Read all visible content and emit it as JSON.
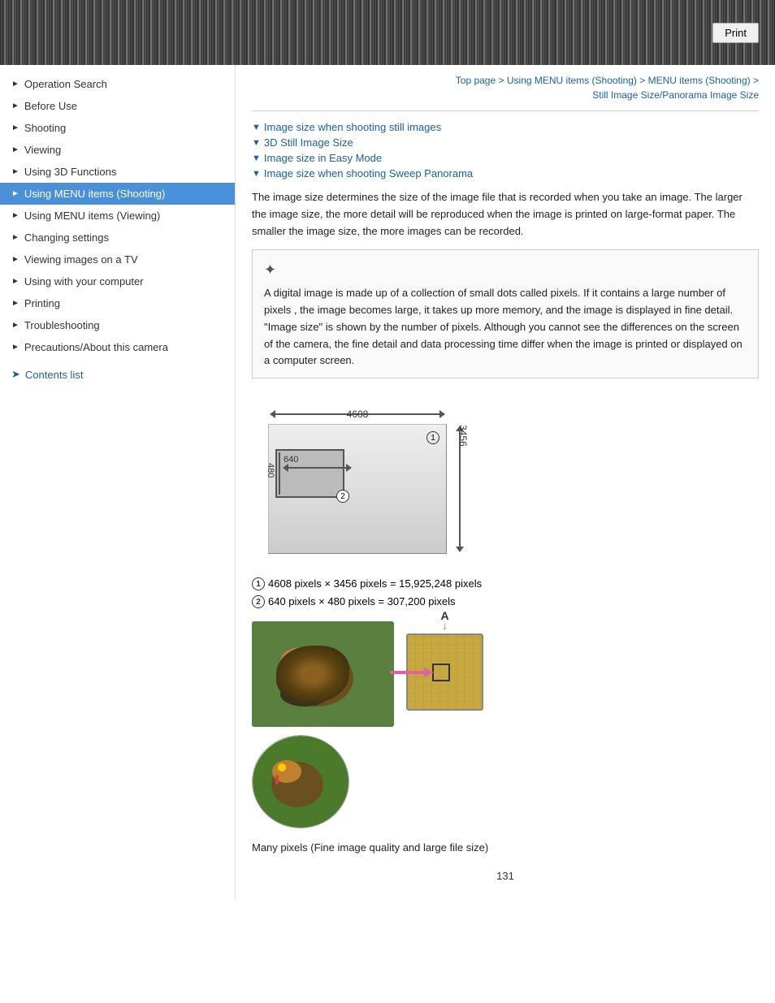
{
  "header": {
    "print_label": "Print"
  },
  "breadcrumb": {
    "part1": "Top page",
    "sep1": " > ",
    "part2": "Using MENU items (Shooting)",
    "sep2": " > ",
    "part3": "MENU items (Shooting)",
    "sep3": " > ",
    "part4": "Still Image Size/Panorama Image Size"
  },
  "sidebar": {
    "items": [
      {
        "label": "Operation Search",
        "active": false
      },
      {
        "label": "Before Use",
        "active": false
      },
      {
        "label": "Shooting",
        "active": false
      },
      {
        "label": "Viewing",
        "active": false
      },
      {
        "label": "Using 3D Functions",
        "active": false
      },
      {
        "label": "Using MENU items (Shooting)",
        "active": true
      },
      {
        "label": "Using MENU items (Viewing)",
        "active": false
      },
      {
        "label": "Changing settings",
        "active": false
      },
      {
        "label": "Viewing images on a TV",
        "active": false
      },
      {
        "label": "Using with your computer",
        "active": false
      },
      {
        "label": "Printing",
        "active": false
      },
      {
        "label": "Troubleshooting",
        "active": false
      },
      {
        "label": "Precautions/About this camera",
        "active": false
      }
    ],
    "contents_link": "Contents list"
  },
  "toc": {
    "items": [
      {
        "label": "Image size when shooting still images"
      },
      {
        "label": "3D Still Image Size"
      },
      {
        "label": "Image size in Easy Mode"
      },
      {
        "label": "Image size when shooting Sweep Panorama"
      }
    ]
  },
  "content": {
    "body1": "The image size determines the size of the image file that is recorded when you take an image. The larger the image size, the more detail will be reproduced when the image is printed on large-format paper. The smaller the image size, the more images can be recorded.",
    "note_text": "A digital image is made up of a collection of small dots called pixels. If it contains a large number of pixels     , the image becomes large, it takes up more memory, and the image is displayed in fine detail. \"Image size\" is shown by the number of pixels. Although you cannot see the differences on the screen of the camera, the fine detail and data processing time differ when the image is printed or displayed on a computer screen.",
    "diagram": {
      "label_4608": "4608",
      "label_3456": "3456",
      "label_640": "640",
      "label_480": "480",
      "num1": "①",
      "num2": "②"
    },
    "pixel1": {
      "circle": "①",
      "text": "4608 pixels × 3456 pixels = 15,925,248 pixels"
    },
    "pixel2": {
      "circle": "②",
      "text": "640 pixels × 480 pixels = 307,200 pixels"
    },
    "caption": "Many pixels (Fine image quality and large file size)",
    "label_A": "A",
    "page_number": "131"
  }
}
